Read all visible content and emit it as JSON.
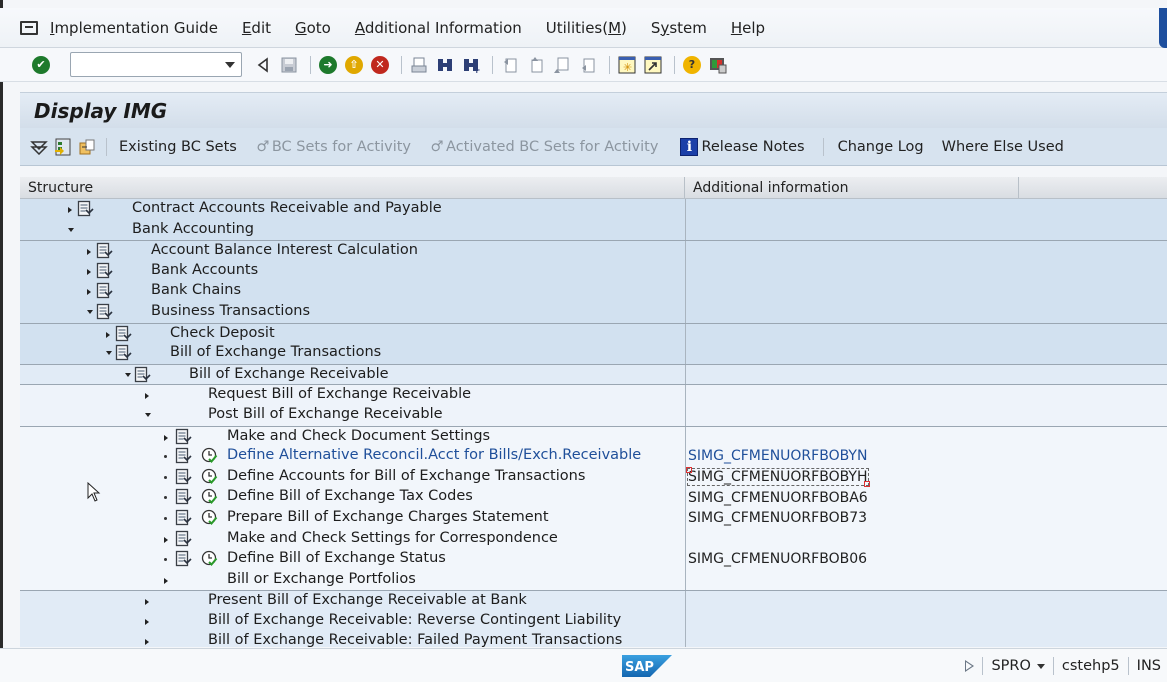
{
  "menubar": {
    "items": [
      {
        "label": "Implementation Guide",
        "mnemonic": "I"
      },
      {
        "label": "Edit",
        "mnemonic": "E"
      },
      {
        "label": "Goto",
        "mnemonic": "G"
      },
      {
        "label": "Additional Information",
        "mnemonic": "A"
      },
      {
        "label": "Utilities(M)",
        "mnemonic": "M"
      },
      {
        "label": "System",
        "mnemonic": "y"
      },
      {
        "label": "Help",
        "mnemonic": "H"
      }
    ]
  },
  "toolbar": {
    "command_field_value": "",
    "buttons": [
      "enter-icon",
      "back-arrow-icon",
      "save-icon",
      "back-icon",
      "exit-icon",
      "cancel-icon",
      "print-icon",
      "find-icon",
      "find-next-icon",
      "first-page-icon",
      "previous-page-icon",
      "next-page-icon",
      "last-page-icon",
      "create-session-icon",
      "create-shortcut-icon",
      "help-icon",
      "customize-layout-icon"
    ]
  },
  "title": "Display IMG",
  "app_toolbar": {
    "icons": [
      "filter-icon",
      "img-structure-icon",
      "export-icon"
    ],
    "buttons": [
      {
        "label": "Existing BC Sets",
        "enabled": true
      },
      {
        "label": "BC Sets for Activity",
        "enabled": false
      },
      {
        "label": "Activated BC Sets for Activity",
        "enabled": false
      },
      {
        "label": "Release Notes",
        "enabled": true
      },
      {
        "label": "Change Log",
        "enabled": true
      },
      {
        "label": "Where Else Used",
        "enabled": true
      }
    ]
  },
  "tree": {
    "columns": [
      "Structure",
      "Additional information",
      ""
    ],
    "rows": [
      {
        "label": "Contract Accounts Receivable and Payable",
        "level": 0,
        "state": "collapsed",
        "doc": true,
        "clock": false,
        "info": "",
        "bg": "d",
        "group_start": false
      },
      {
        "label": "Bank Accounting",
        "level": 0,
        "state": "expanded",
        "doc": false,
        "clock": false,
        "info": "",
        "bg": "d",
        "group_start": false
      },
      {
        "label": "Account Balance Interest Calculation",
        "level": 1,
        "state": "collapsed",
        "doc": true,
        "clock": false,
        "info": "",
        "bg": "d",
        "group_start": true
      },
      {
        "label": "Bank Accounts",
        "level": 1,
        "state": "collapsed",
        "doc": true,
        "clock": false,
        "info": "",
        "bg": "d",
        "group_start": false
      },
      {
        "label": "Bank Chains",
        "level": 1,
        "state": "collapsed",
        "doc": true,
        "clock": false,
        "info": "",
        "bg": "d",
        "group_start": false
      },
      {
        "label": "Business Transactions",
        "level": 1,
        "state": "expanded",
        "doc": true,
        "clock": false,
        "info": "",
        "bg": "d",
        "group_start": false
      },
      {
        "label": "Check Deposit",
        "level": 2,
        "state": "collapsed",
        "doc": true,
        "clock": false,
        "info": "",
        "bg": "d",
        "group_start": true
      },
      {
        "label": "Bill of Exchange Transactions",
        "level": 2,
        "state": "expanded",
        "doc": true,
        "clock": false,
        "info": "",
        "bg": "d",
        "group_start": false
      },
      {
        "label": "Bill of Exchange Receivable",
        "level": 3,
        "state": "expanded",
        "doc": true,
        "clock": false,
        "info": "",
        "bg": "m",
        "group_start": true
      },
      {
        "label": "Request Bill of Exchange Receivable",
        "level": 4,
        "state": "collapsed",
        "doc": false,
        "clock": false,
        "info": "",
        "bg": "l",
        "group_start": true
      },
      {
        "label": "Post Bill of Exchange Receivable",
        "level": 4,
        "state": "expanded",
        "doc": false,
        "clock": false,
        "info": "",
        "bg": "l",
        "group_start": false
      },
      {
        "label": "Make and Check Document Settings",
        "level": 5,
        "state": "collapsed",
        "doc": true,
        "clock": false,
        "info": "",
        "bg": "w",
        "group_start": true
      },
      {
        "label": "Define Alternative Reconcil.Acct for Bills/Exch.Receivable",
        "level": 5,
        "state": "leaf",
        "doc": true,
        "clock": true,
        "info": "SIMG_CFMENUORFBOBYN",
        "bg": "w",
        "group_start": false,
        "link": true
      },
      {
        "label": "Define Accounts for Bill of Exchange Transactions",
        "level": 5,
        "state": "leaf",
        "doc": true,
        "clock": true,
        "info": "SIMG_CFMENUORFBOBYH",
        "bg": "w",
        "group_start": false,
        "focused": true
      },
      {
        "label": "Define Bill of Exchange Tax Codes",
        "level": 5,
        "state": "leaf",
        "doc": true,
        "clock": true,
        "info": "SIMG_CFMENUORFBOBA6",
        "bg": "w",
        "group_start": false
      },
      {
        "label": "Prepare Bill of Exchange Charges Statement",
        "level": 5,
        "state": "leaf",
        "doc": true,
        "clock": true,
        "info": "SIMG_CFMENUORFBOB73",
        "bg": "w",
        "group_start": false
      },
      {
        "label": "Make and Check Settings for Correspondence",
        "level": 5,
        "state": "collapsed",
        "doc": true,
        "clock": false,
        "info": "",
        "bg": "w",
        "group_start": false
      },
      {
        "label": "Define Bill of Exchange Status",
        "level": 5,
        "state": "leaf",
        "doc": true,
        "clock": true,
        "info": "SIMG_CFMENUORFBOB06",
        "bg": "w",
        "group_start": false
      },
      {
        "label": "Bill or Exchange Portfolios",
        "level": 5,
        "state": "collapsed",
        "doc": false,
        "clock": false,
        "info": "",
        "bg": "w",
        "group_start": false
      },
      {
        "label": "Present Bill of Exchange Receivable at Bank",
        "level": 4,
        "state": "collapsed",
        "doc": false,
        "clock": false,
        "info": "",
        "bg": "m",
        "group_start": true
      },
      {
        "label": "Bill of Exchange Receivable: Reverse Contingent Liability",
        "level": 4,
        "state": "collapsed",
        "doc": false,
        "clock": false,
        "info": "",
        "bg": "m",
        "group_start": false
      },
      {
        "label": "Bill of Exchange Receivable: Failed Payment Transactions",
        "level": 4,
        "state": "collapsed",
        "doc": false,
        "clock": false,
        "info": "",
        "bg": "m",
        "group_start": false
      }
    ]
  },
  "statusbar": {
    "logo": "SAP",
    "transaction": "SPRO",
    "system": "cstehp5",
    "mode": "INS"
  },
  "colors": {
    "link": "#1f4f9a",
    "row_dark": "#d2e1f0",
    "row_mid": "#e1ebf6",
    "row_light": "#eef3fa",
    "sap_blue": "#1b75bc"
  }
}
